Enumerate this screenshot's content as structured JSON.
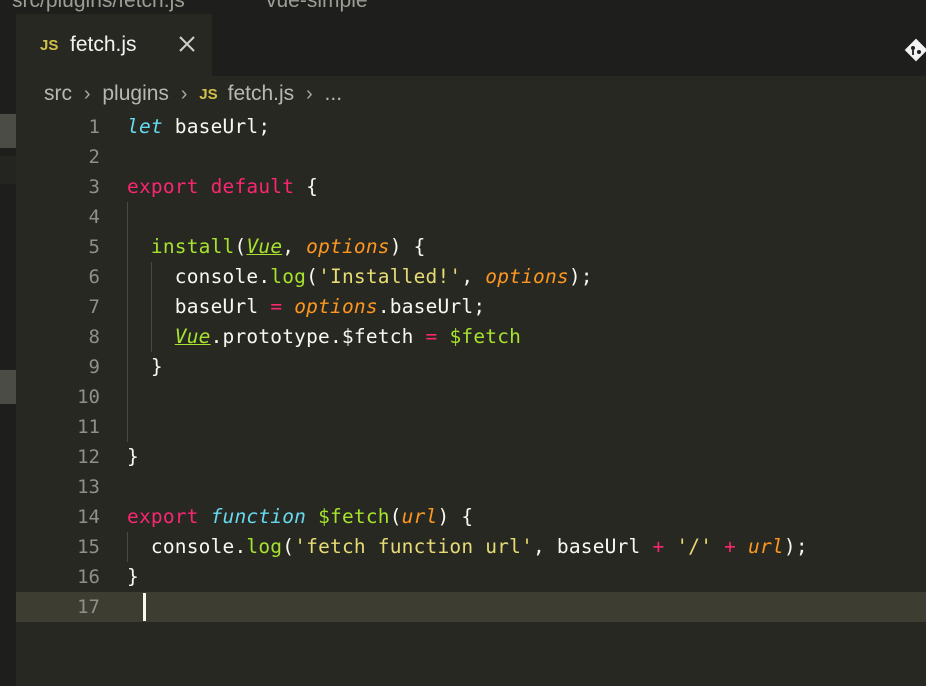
{
  "window": {
    "title_left": "src/plugins/fetch.js",
    "title_right": "vue-simple"
  },
  "tab": {
    "icon": "JS",
    "label": "fetch.js",
    "close_icon": "close-icon"
  },
  "breadcrumb": {
    "items": [
      "src",
      "plugins",
      "fetch.js",
      "..."
    ],
    "file_icon": "JS"
  },
  "editor": {
    "current_line": 17,
    "lines": [
      {
        "n": "1"
      },
      {
        "n": "2"
      },
      {
        "n": "3"
      },
      {
        "n": "4"
      },
      {
        "n": "5"
      },
      {
        "n": "6"
      },
      {
        "n": "7"
      },
      {
        "n": "8"
      },
      {
        "n": "9"
      },
      {
        "n": "10"
      },
      {
        "n": "11"
      },
      {
        "n": "12"
      },
      {
        "n": "13"
      },
      {
        "n": "14"
      },
      {
        "n": "15"
      },
      {
        "n": "16"
      },
      {
        "n": "17"
      }
    ],
    "tokens": {
      "l1_let": "let",
      "l1_rest": " baseUrl;",
      "export": "export",
      "default": "default",
      "brace_open": " {",
      "install": "install",
      "vue": "Vue",
      "options": "options",
      "console": "console.",
      "log": "log",
      "installed_str": "'Installed!'",
      "baseUrl": "baseUrl",
      "assign": "=",
      "dot_baseUrl": ".baseUrl;",
      "proto": ".prototype.$fetch",
      "fetch_ref": "$fetch",
      "close_brace": "}",
      "function": "function",
      "fetch_fn": "$fetch",
      "url": "url",
      "fetch_str": "'fetch function url'",
      "slash_str": "'/'",
      "plus": "+"
    }
  },
  "colors": {
    "background": "#272822",
    "keyword": "#f92672",
    "storage": "#66d9ef",
    "function": "#a6e22e",
    "parameter": "#fd971f",
    "string": "#e6db74"
  }
}
